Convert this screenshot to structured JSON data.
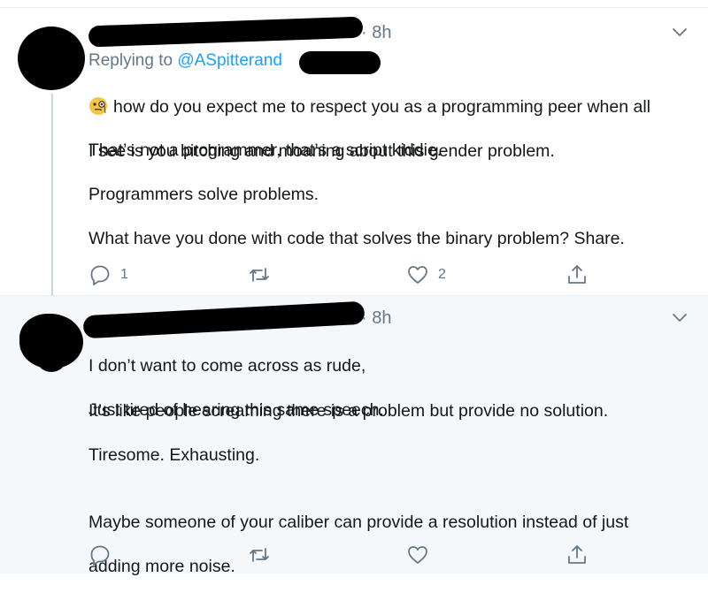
{
  "tweets": [
    {
      "time": "· 8h",
      "replying_prefix": "Replying to ",
      "replying_handle": "@ASpitterand",
      "line1": "how do you expect me to respect you as a programming peer when all",
      "line2": "I see is you bitching and moaning about this gender problem.",
      "p2": "That’s not a programmer, that’s a script kiddie.",
      "p3": "Programmers solve problems.",
      "p4": "What have you done with code that solves the binary problem? Share.",
      "reply_count": "1",
      "like_count": "2",
      "emoji_icon": "face-with-monocle-icon"
    },
    {
      "time": "· 8h",
      "p1a": "I don’t want to come across as rude,",
      "p1b": "Just tired of hearing this same speech.",
      "p2": "It’s like people screaming there is a problem but provide no solution.",
      "p3": "Tiresome. Exhausting.",
      "p4a": "Maybe someone of your caliber can provide a resolution instead of just",
      "p4b": "adding more noise."
    }
  ],
  "colors": {
    "secondary_text": "#657786",
    "link": "#1da1f2",
    "alt_background": "#f5f8fa",
    "divider": "#e6ecf0"
  }
}
